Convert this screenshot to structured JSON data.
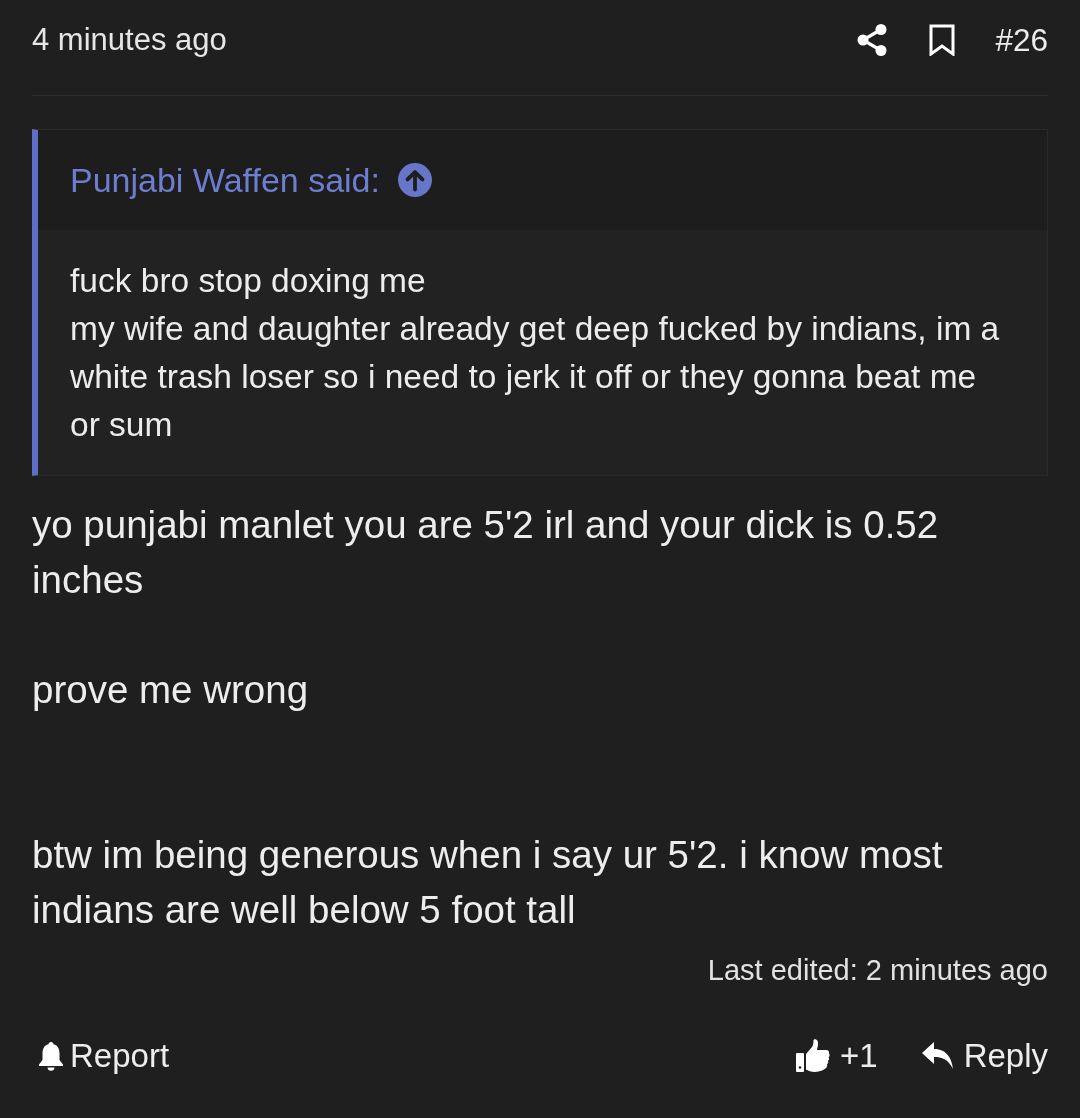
{
  "post": {
    "time": "4 minutes ago",
    "number": "#26"
  },
  "quote": {
    "attribution": "Punjabi Waffen said:",
    "text": "fuck bro stop doxing me\nmy wife and daughter already get deep fucked by indians, im a white trash loser so i need to jerk it off or they gonna beat me or sum"
  },
  "message": "yo punjabi manlet you are 5'2 irl and your dick is 0.52 inches\n\nprove me wrong\n\n\nbtw im being generous when i say ur 5'2. i know most indians are well below 5 foot tall",
  "last_edited": "Last edited: 2 minutes ago",
  "actions": {
    "report": "Report",
    "like": "+1",
    "reply": "Reply"
  }
}
